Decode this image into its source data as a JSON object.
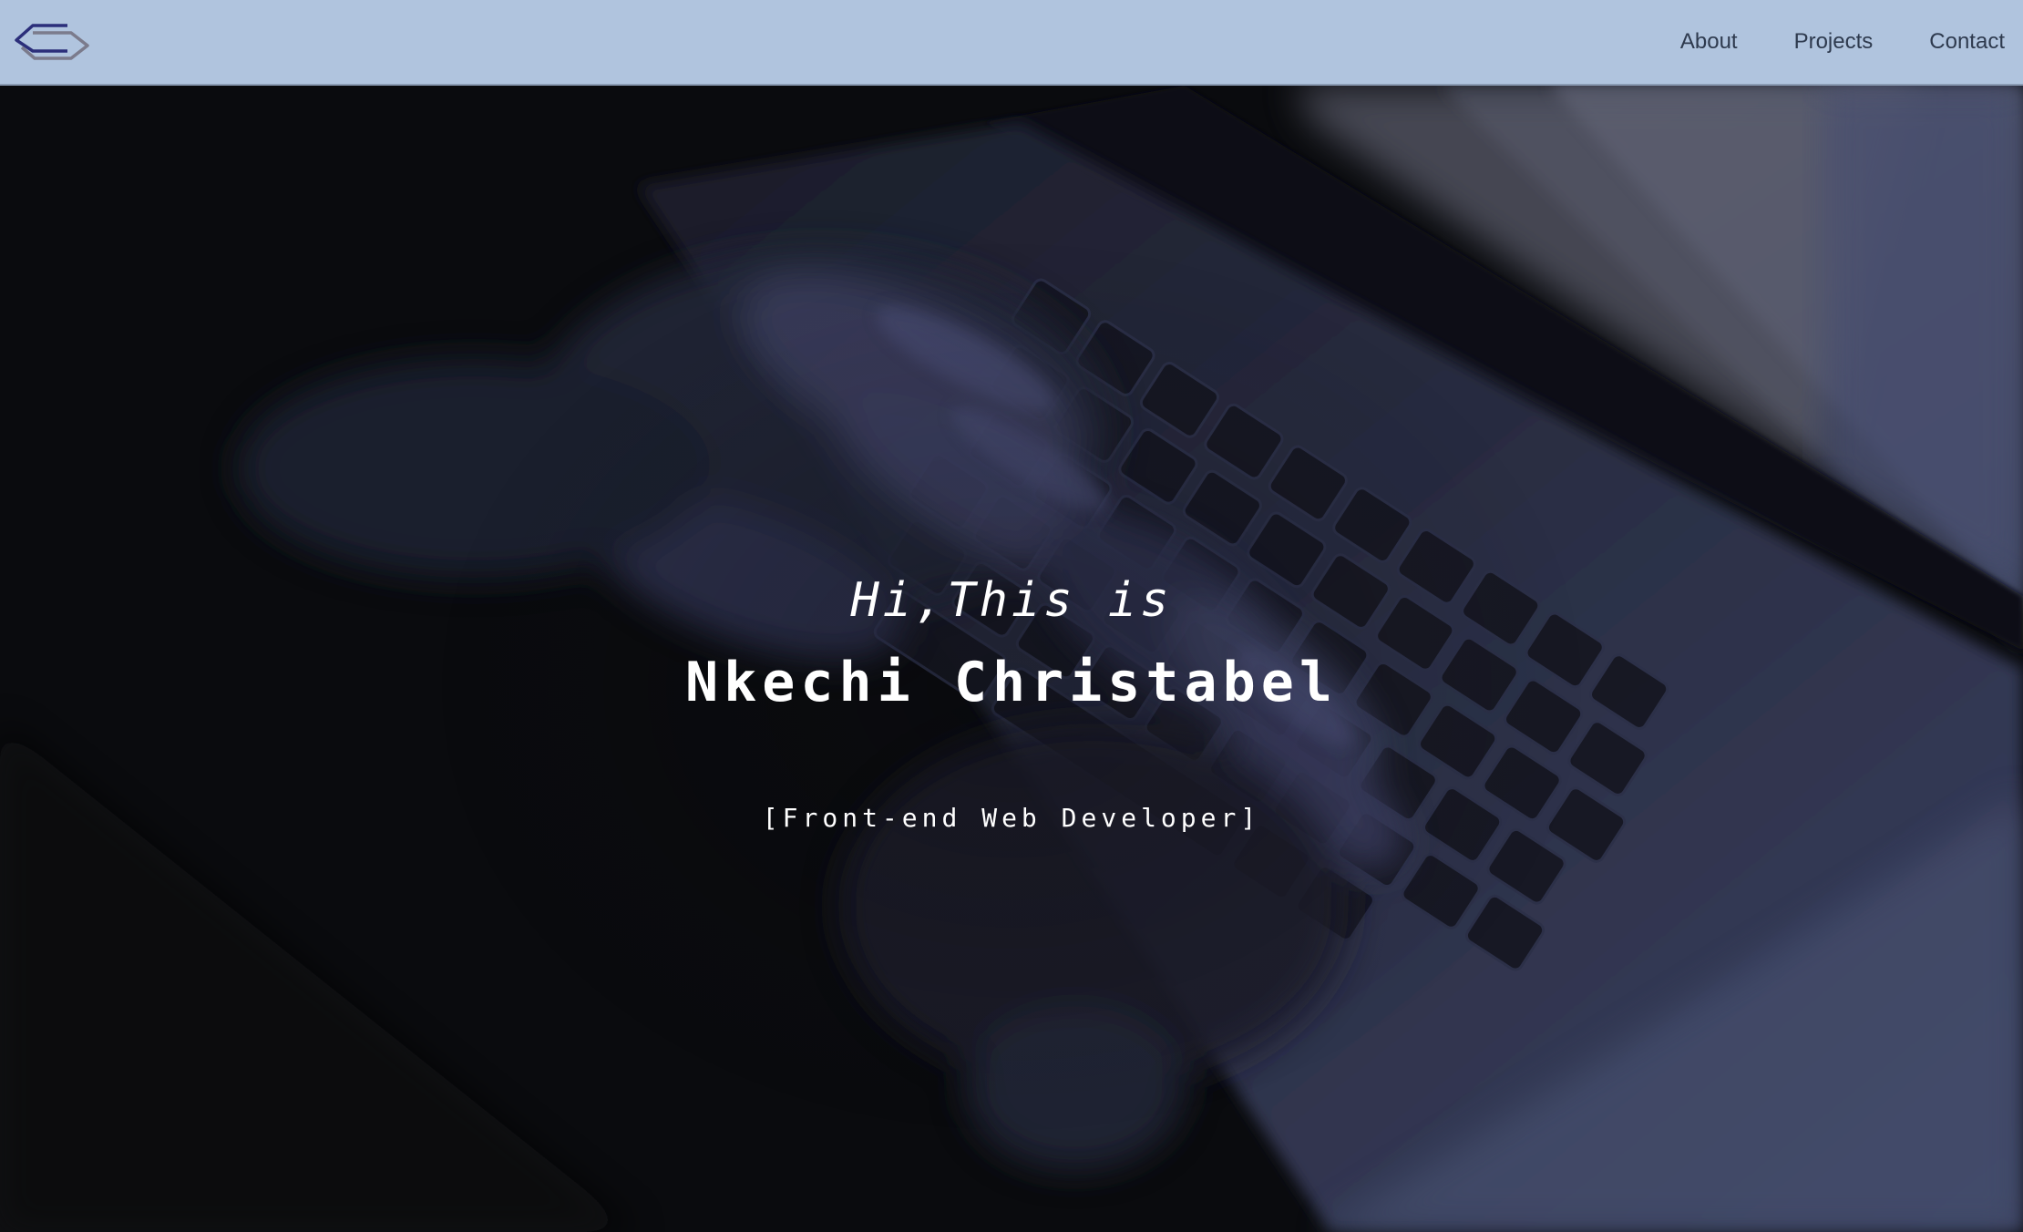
{
  "nav": {
    "logo_icon": "hexagon-logo-icon",
    "links": [
      "About",
      "Projects",
      "Contact"
    ]
  },
  "hero": {
    "greeting": "Hi,This is",
    "name": "Nkechi Christabel",
    "role": "[Front-end Web Developer]",
    "background": "dark photo of hands typing on a laptop keyboard"
  },
  "colors": {
    "navbar_bg": "#b0c4de",
    "nav_text": "#2e3a4e",
    "hero_text": "#ffffff",
    "hero_bg": "#0a0b0e",
    "logo_primary": "#2b2e7a",
    "logo_secondary": "#7b7b8c"
  }
}
